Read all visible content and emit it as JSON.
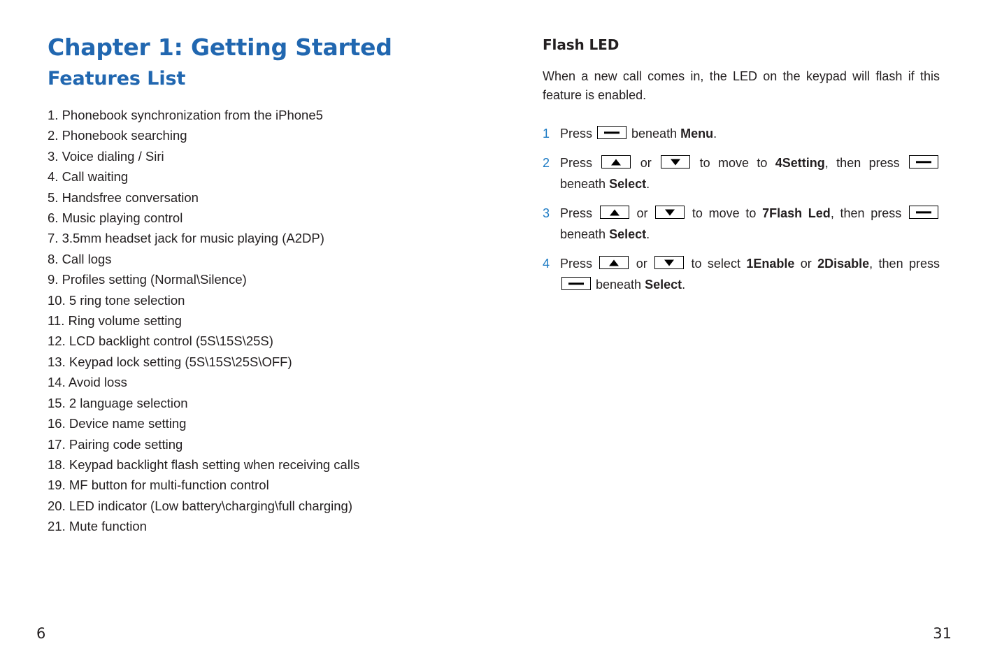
{
  "colors": {
    "heading_blue": "#2167B0",
    "step_number_blue": "#1B7AC4",
    "body_text": "#231f20",
    "page_background": "#ffffff"
  },
  "left_page": {
    "chapter_title": "Chapter 1: Getting Started",
    "section_title": "Features List",
    "features": [
      "1. Phonebook synchronization from the iPhone5",
      "2. Phonebook searching",
      "3. Voice dialing / Siri",
      "4. Call waiting",
      "5. Handsfree conversation",
      "6. Music playing control",
      "7. 3.5mm headset jack for music playing (A2DP)",
      "8. Call logs",
      "9. Profiles setting (Normal\\Silence)",
      "10. 5 ring tone selection",
      "11. Ring volume setting",
      "12. LCD backlight control (5S\\15S\\25S)",
      "13. Keypad lock setting (5S\\15S\\25S\\OFF)",
      "14. Avoid loss",
      "15. 2 language selection",
      "16. Device name setting",
      "17. Pairing code setting",
      "18. Keypad backlight flash setting when receiving calls",
      "19. MF button for multi-function control",
      "20. LED indicator (Low battery\\charging\\full charging)",
      "21. Mute function"
    ],
    "page_number": "6"
  },
  "right_page": {
    "sub_title": "Flash LED",
    "intro_paragraph": "When a new call comes in, the LED on the keypad will flash if this feature is enabled.",
    "steps": [
      {
        "number": "1",
        "parts": [
          {
            "type": "text",
            "value": "Press "
          },
          {
            "type": "key",
            "icon": "dash-key-icon"
          },
          {
            "type": "text",
            "value": " beneath "
          },
          {
            "type": "bold",
            "value": "Menu"
          },
          {
            "type": "text",
            "value": "."
          }
        ]
      },
      {
        "number": "2",
        "parts": [
          {
            "type": "text",
            "value": "Press "
          },
          {
            "type": "key",
            "icon": "up-arrow-key-icon"
          },
          {
            "type": "text",
            "value": " or "
          },
          {
            "type": "key",
            "icon": "down-arrow-key-icon"
          },
          {
            "type": "text",
            "value": " to move to "
          },
          {
            "type": "bold",
            "value": "4Setting"
          },
          {
            "type": "text",
            "value": ", then press "
          },
          {
            "type": "key",
            "icon": "dash-key-icon"
          },
          {
            "type": "text",
            "value": " beneath "
          },
          {
            "type": "bold",
            "value": "Select"
          },
          {
            "type": "text",
            "value": "."
          }
        ]
      },
      {
        "number": "3",
        "parts": [
          {
            "type": "text",
            "value": "Press "
          },
          {
            "type": "key",
            "icon": "up-arrow-key-icon"
          },
          {
            "type": "text",
            "value": " or "
          },
          {
            "type": "key",
            "icon": "down-arrow-key-icon"
          },
          {
            "type": "text",
            "value": " to move to "
          },
          {
            "type": "bold",
            "value": "7Flash Led"
          },
          {
            "type": "text",
            "value": ", then press "
          },
          {
            "type": "key",
            "icon": "dash-key-icon"
          },
          {
            "type": "text",
            "value": " beneath "
          },
          {
            "type": "bold",
            "value": "Select"
          },
          {
            "type": "text",
            "value": "."
          }
        ]
      },
      {
        "number": "4",
        "parts": [
          {
            "type": "text",
            "value": "Press "
          },
          {
            "type": "key",
            "icon": "up-arrow-key-icon"
          },
          {
            "type": "text",
            "value": " or "
          },
          {
            "type": "key",
            "icon": "down-arrow-key-icon"
          },
          {
            "type": "text",
            "value": " to select "
          },
          {
            "type": "bold",
            "value": "1Enable"
          },
          {
            "type": "text",
            "value": " or "
          },
          {
            "type": "bold",
            "value": "2Disable"
          },
          {
            "type": "text",
            "value": ", then press "
          },
          {
            "type": "key",
            "icon": "dash-key-icon"
          },
          {
            "type": "text",
            "value": " beneath "
          },
          {
            "type": "bold",
            "value": "Select"
          },
          {
            "type": "text",
            "value": "."
          }
        ]
      }
    ],
    "page_number": "31"
  }
}
